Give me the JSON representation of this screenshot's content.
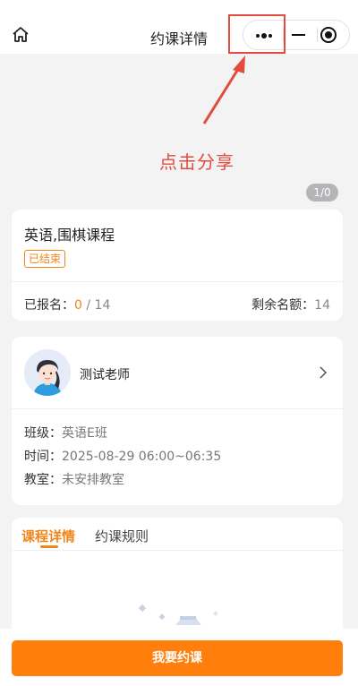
{
  "navbar": {
    "title": "约课详情",
    "home_icon": "home-icon",
    "more_icon": "more-dots-icon",
    "minimize_icon": "minimize-icon",
    "close_icon": "target-close-icon"
  },
  "annotation": {
    "hint": "点击分享",
    "color": "#e34b3f"
  },
  "banner": {
    "counter": "1/0"
  },
  "course": {
    "title": "英语,围棋课程",
    "status": "已结束",
    "enrolled_label": "已报名：",
    "enrolled_count": "0",
    "enrolled_total": " / 14",
    "remaining_label": "剩余名额：",
    "remaining_value": "14"
  },
  "teacher": {
    "name": "测试老师",
    "class_label": "班级：",
    "class_value": "英语E班",
    "time_label": "时间：",
    "time_value": "2025-08-29 06:00~06:35",
    "room_label": "教室：",
    "room_value": "未安排教室"
  },
  "tabs": [
    {
      "label": "课程详情",
      "active": true
    },
    {
      "label": "约课规则",
      "active": false
    }
  ],
  "action": {
    "book_label": "我要约课"
  },
  "colors": {
    "accent": "#f08519",
    "button": "#ff7e0c",
    "annotation": "#e34b3f"
  }
}
